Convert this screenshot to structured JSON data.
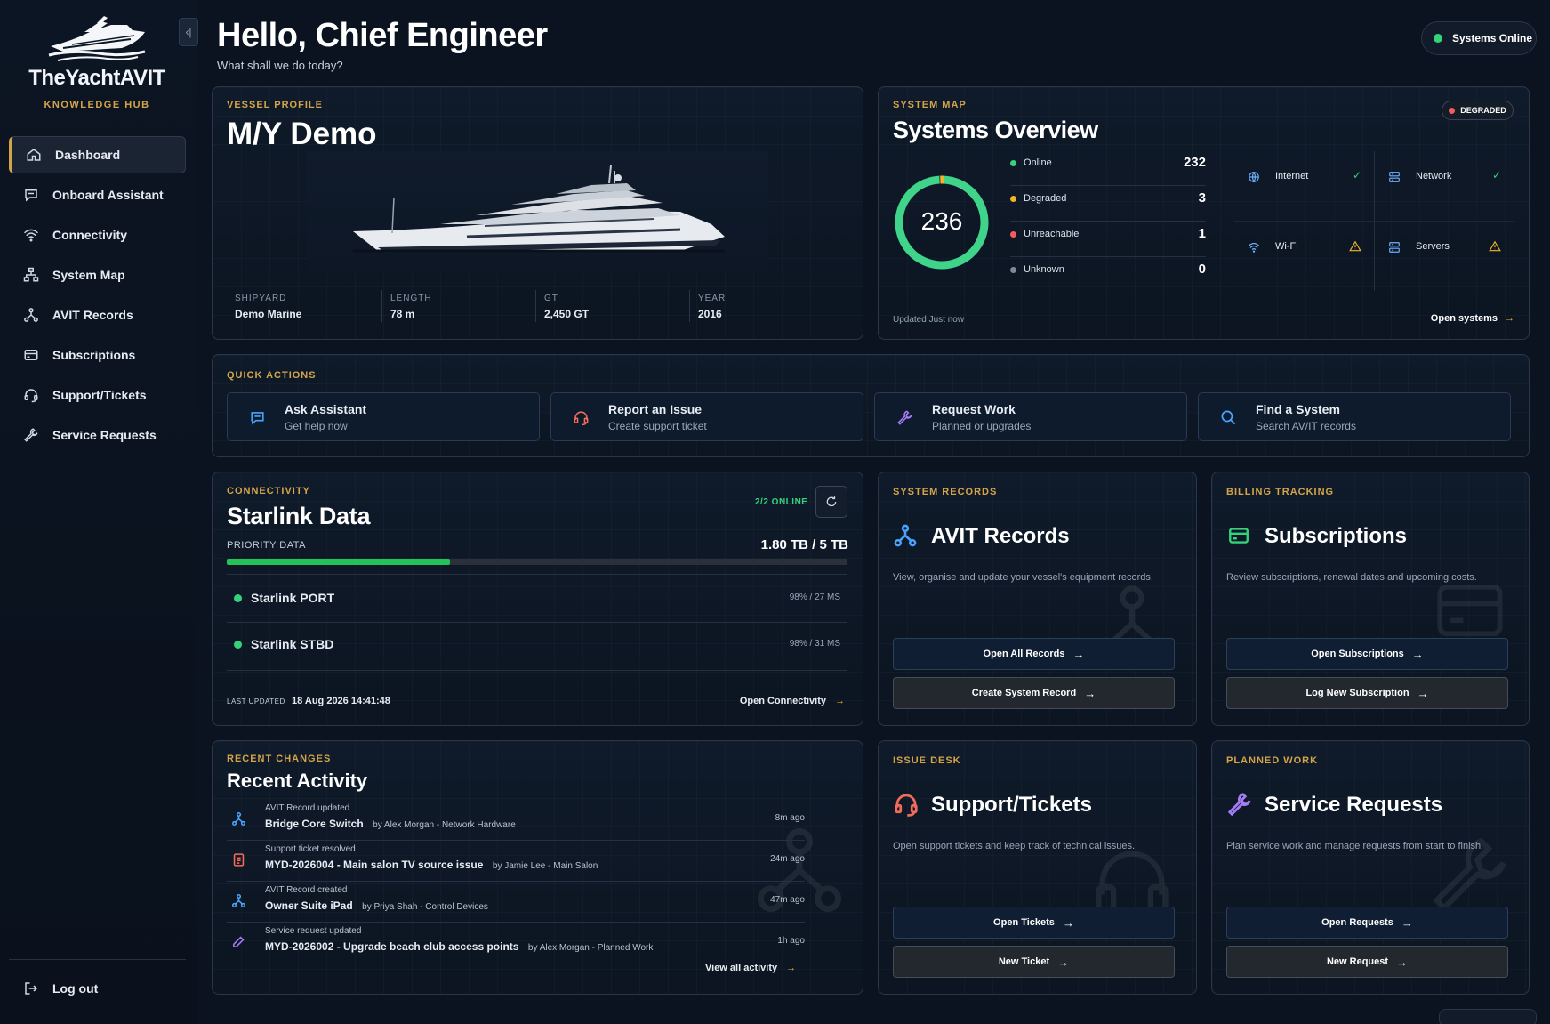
{
  "sidebar": {
    "brand": "TheYachtAVIT",
    "brand_sub": "KNOWLEDGE HUB",
    "collapse_icon": "chevron-left",
    "items": [
      {
        "label": "Dashboard",
        "icon": "home-icon",
        "active": true
      },
      {
        "label": "Onboard Assistant",
        "icon": "chat-icon"
      },
      {
        "label": "Connectivity",
        "icon": "wifi-icon"
      },
      {
        "label": "System Map",
        "icon": "sitemap-icon"
      },
      {
        "label": "AVIT Records",
        "icon": "nodes-icon"
      },
      {
        "label": "Subscriptions",
        "icon": "card-icon"
      },
      {
        "label": "Support/Tickets",
        "icon": "headset-icon"
      },
      {
        "label": "Service Requests",
        "icon": "wrench-icon"
      }
    ],
    "logout": "Log out"
  },
  "header": {
    "title": "Hello, Chief Engineer",
    "subtitle": "What shall we do today?",
    "status": "Systems Online",
    "status_color": "#34d27b"
  },
  "vessel": {
    "eyebrow": "VESSEL PROFILE",
    "name": "M/Y Demo",
    "specs": [
      {
        "label": "SHIPYARD",
        "value": "Demo Marine"
      },
      {
        "label": "LENGTH",
        "value": "78 m"
      },
      {
        "label": "GT",
        "value": "2,450 GT"
      },
      {
        "label": "YEAR",
        "value": "2016"
      }
    ]
  },
  "system_map": {
    "eyebrow": "SYSTEM MAP",
    "title": "Systems Overview",
    "badge": "DEGRADED",
    "total": "236",
    "stats": [
      {
        "label": "Online",
        "value": "232",
        "color": "#34d27b"
      },
      {
        "label": "Degraded",
        "value": "3",
        "color": "#f0b429"
      },
      {
        "label": "Unreachable",
        "value": "1",
        "color": "#f25c5c"
      },
      {
        "label": "Unknown",
        "value": "0",
        "color": "#7d8898"
      }
    ],
    "services": [
      {
        "label": "Internet",
        "status": "ok",
        "icon": "globe-icon"
      },
      {
        "label": "Network",
        "status": "ok",
        "icon": "server-icon"
      },
      {
        "label": "Wi-Fi",
        "status": "warn",
        "icon": "wifi-icon"
      },
      {
        "label": "Servers",
        "status": "warn",
        "icon": "server-icon"
      }
    ],
    "updated": "Updated Just now",
    "open": "Open systems"
  },
  "quick_actions": {
    "eyebrow": "QUICK ACTIONS",
    "items": [
      {
        "title": "Ask Assistant",
        "sub": "Get help now",
        "icon": "chat-icon",
        "color": "#4aa3ff"
      },
      {
        "title": "Report an Issue",
        "sub": "Create support ticket",
        "icon": "headset-icon",
        "color": "#f26b5b"
      },
      {
        "title": "Request Work",
        "sub": "Planned or upgrades",
        "icon": "wrench-icon",
        "color": "#a57cf5"
      },
      {
        "title": "Find a System",
        "sub": "Search AV/IT records",
        "icon": "search-icon",
        "color": "#4aa3ff"
      }
    ]
  },
  "connectivity": {
    "eyebrow": "CONNECTIVITY",
    "title": "Starlink Data",
    "online": "2/2 ONLINE",
    "priority_label": "PRIORITY DATA",
    "usage": "1.80 TB / 5 TB",
    "usage_fraction": 0.36,
    "links": [
      {
        "name": "Starlink PORT",
        "stats": "98% / 27 MS"
      },
      {
        "name": "Starlink STBD",
        "stats": "98% / 31 MS"
      }
    ],
    "last_updated_label": "LAST UPDATED",
    "last_updated": "18 Aug 2026 14:41:48",
    "open": "Open Connectivity"
  },
  "avit_records": {
    "eyebrow": "SYSTEM RECORDS",
    "title": "AVIT Records",
    "desc": "View, organise and update your vessel's equipment records.",
    "btn1": "Open All Records",
    "btn2": "Create System Record",
    "color": "#4aa3ff"
  },
  "subscriptions": {
    "eyebrow": "BILLING TRACKING",
    "title": "Subscriptions",
    "desc": "Review subscriptions, renewal dates and upcoming costs.",
    "btn1": "Open Subscriptions",
    "btn2": "Log New Subscription",
    "color": "#34d27b"
  },
  "activity": {
    "eyebrow": "RECENT CHANGES",
    "title": "Recent Activity",
    "items": [
      {
        "type": "AVIT Record updated",
        "title": "Bridge Core Switch",
        "by": "by Alex Morgan - Network Hardware",
        "time": "8m ago",
        "icon": "nodes-icon",
        "color": "#4aa3ff"
      },
      {
        "type": "Support ticket resolved",
        "title": "MYD-2026004 - Main salon TV source issue",
        "by": "by Jamie Lee - Main Salon",
        "time": "24m ago",
        "icon": "ticket-icon",
        "color": "#f26b5b"
      },
      {
        "type": "AVIT Record created",
        "title": "Owner Suite iPad",
        "by": "by Priya Shah - Control Devices",
        "time": "47m ago",
        "icon": "nodes-icon",
        "color": "#4aa3ff"
      },
      {
        "type": "Service request updated",
        "title": "MYD-2026002 - Upgrade beach club access points",
        "by": "by Alex Morgan - Planned Work",
        "time": "1h ago",
        "icon": "pencil-icon",
        "color": "#a57cf5"
      }
    ],
    "view_all": "View all activity"
  },
  "tickets": {
    "eyebrow": "ISSUE DESK",
    "title": "Support/Tickets",
    "desc": "Open support tickets and keep track of technical issues.",
    "btn1": "Open Tickets",
    "btn2": "New Ticket",
    "color": "#f26b5b"
  },
  "service": {
    "eyebrow": "PLANNED WORK",
    "title": "Service Requests",
    "desc": "Plan service work and manage requests from start to finish.",
    "btn1": "Open Requests",
    "btn2": "New Request",
    "color": "#a57cf5"
  }
}
